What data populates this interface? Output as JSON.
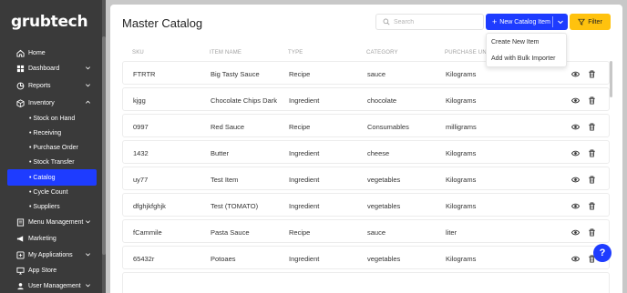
{
  "app": {
    "logo": "grubtech"
  },
  "sidebar": {
    "items": [
      {
        "label": "Home",
        "icon": "home-icon",
        "has_chevron": false,
        "chevron": ""
      },
      {
        "label": "Dashboard",
        "icon": "dashboard-icon",
        "has_chevron": true,
        "chevron": "down"
      },
      {
        "label": "Reports",
        "icon": "reports-icon",
        "has_chevron": true,
        "chevron": "down"
      },
      {
        "label": "Inventory",
        "icon": "inventory-icon",
        "has_chevron": true,
        "chevron": "up"
      },
      {
        "label": "• Stock on Hand",
        "sub": true
      },
      {
        "label": "• Receiving",
        "sub": true
      },
      {
        "label": "• Purchase Order",
        "sub": true
      },
      {
        "label": "• Stock Transfer",
        "sub": true
      },
      {
        "label": "• Catalog",
        "sub": true,
        "active": true
      },
      {
        "label": "• Cycle Count",
        "sub": true
      },
      {
        "label": "• Suppliers",
        "sub": true
      },
      {
        "label": "Menu Management",
        "icon": "menu-icon",
        "has_chevron": true,
        "chevron": "down"
      },
      {
        "label": "Marketing",
        "icon": "marketing-icon",
        "has_chevron": false
      },
      {
        "label": "My Applications",
        "icon": "apps-icon",
        "has_chevron": true,
        "chevron": "down"
      },
      {
        "label": "App Store",
        "icon": "store-icon",
        "has_chevron": false
      },
      {
        "label": "User Management",
        "icon": "user-icon",
        "has_chevron": true,
        "chevron": "down"
      }
    ]
  },
  "main": {
    "title": "Master Catalog",
    "search": {
      "placeholder": "Search",
      "value": ""
    },
    "new_button": {
      "label": "New Catalog Item",
      "plus": "+"
    },
    "filter_button": {
      "label": "Filter"
    },
    "dropdown": {
      "options": [
        "Create New Item",
        "Add with Bulk Importer"
      ]
    },
    "table": {
      "columns": [
        "SKU",
        "ITEM NAME",
        "TYPE",
        "CATEGORY",
        "PURCHASE UNIT"
      ],
      "rows": [
        [
          "FTRTR",
          "Big Tasty Sauce",
          "Recipe",
          "sauce",
          "Kilograms"
        ],
        [
          "kjgg",
          "Chocolate Chips Dark",
          "Ingredient",
          "chocolate",
          "Kilograms"
        ],
        [
          "0997",
          "Red Sauce",
          "Recipe",
          "Consumables",
          "milligrams"
        ],
        [
          "1432",
          "Butter",
          "Ingredient",
          "cheese",
          "Kilograms"
        ],
        [
          "uy77",
          "Test Item",
          "Ingredient",
          "vegetables",
          "Kilograms"
        ],
        [
          "dfghjkfghjk",
          "Test (TOMATO)",
          "Ingredient",
          "vegetables",
          "Kilograms"
        ],
        [
          "fCammile",
          "Pasta Sauce",
          "Recipe",
          "sauce",
          "liter"
        ],
        [
          "65432r",
          "Potoaes",
          "Ingredient",
          "vegetables",
          "Kilograms"
        ],
        [
          "",
          "",
          "",
          "",
          ""
        ]
      ]
    },
    "help_label": "?"
  },
  "colors": {
    "accent": "#1e3cff",
    "filter": "#ffc20e",
    "sidebar": "#3a3a3a"
  }
}
